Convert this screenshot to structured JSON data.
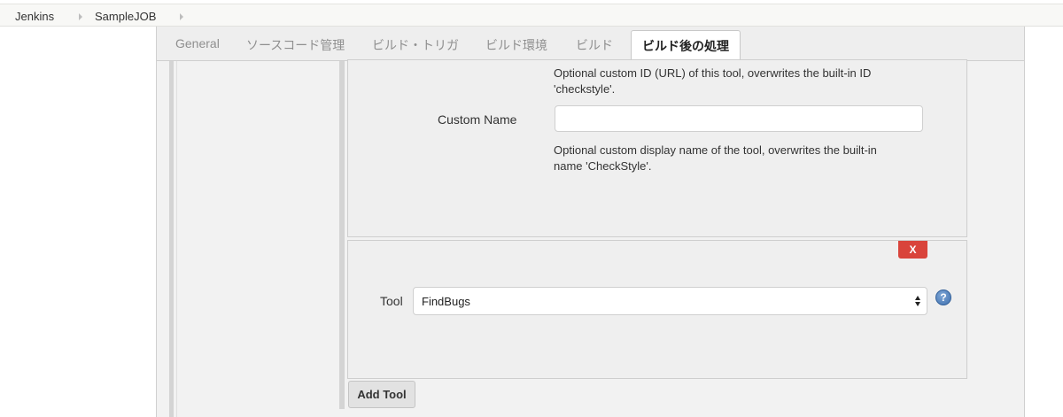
{
  "breadcrumb": {
    "items": [
      "Jenkins",
      "SampleJOB"
    ]
  },
  "tabs": [
    {
      "label": "General",
      "active": false
    },
    {
      "label": "ソースコード管理",
      "active": false
    },
    {
      "label": "ビルド・トリガ",
      "active": false
    },
    {
      "label": "ビルド環境",
      "active": false
    },
    {
      "label": "ビルド",
      "active": false
    },
    {
      "label": "ビルド後の処理",
      "active": true
    }
  ],
  "panel1": {
    "id_help": "Optional custom ID (URL) of this tool, overwrites the built-in ID 'checkstyle'.",
    "custom_name_label": "Custom Name",
    "custom_name_value": "",
    "name_help": "Optional custom display name of the tool, overwrites the built-in name 'CheckStyle'."
  },
  "panel2": {
    "delete_label": "X",
    "tool_label": "Tool",
    "tool_value": "FindBugs",
    "help_icon_text": "?"
  },
  "add_tool_label": "Add Tool",
  "colors": {
    "delete_button": "#d9443b",
    "help_icon": "#3e6fae",
    "active_tab_bg": "#ffffff"
  }
}
